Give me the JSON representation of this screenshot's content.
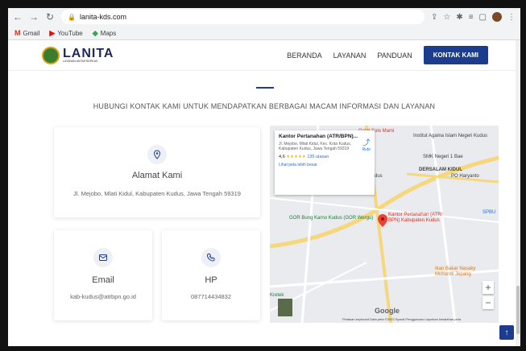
{
  "browser": {
    "url": "lanita-kds.com",
    "bookmarks": [
      {
        "label": "Gmail",
        "icon": "gmail-icon"
      },
      {
        "label": "YouTube",
        "icon": "youtube-icon"
      },
      {
        "label": "Maps",
        "icon": "maps-icon"
      }
    ]
  },
  "header": {
    "logo_title": "LANITA",
    "logo_sub": "LAYANAN ANTAR BERKAS",
    "nav": [
      "BERANDA",
      "LAYANAN",
      "PANDUAN"
    ],
    "contact_label": "KONTAK KAMI"
  },
  "section_title": "HUBUNGI KONTAK KAMI UNTUK MENDAPATKAN BERBAGAI MACAM INFORMASI DAN LAYANAN",
  "cards": {
    "address": {
      "title": "Alamat Kami",
      "text": "Jl. Mejobo, Mlati Kidul, Kabupaten Kudus, Jawa Tengah 59319"
    },
    "email": {
      "title": "Email",
      "text": "kab-kudus@atrbpn.go.id"
    },
    "phone": {
      "title": "HP",
      "text": "087714434832"
    }
  },
  "map": {
    "info_title": "Kantor Pertanahan (ATR/BPN)...",
    "info_address": "Jl. Mejobo, Mlati Kidul, Kec. Kota Kudus, Kabupaten Kudus, Jawa Tengah 59319",
    "rating": "4,6",
    "stars": "★★★★★",
    "reviews": "135 ulasan",
    "link": "Lihat peta lebih besar",
    "route": "Rute",
    "labels": {
      "pin": "Kantor Pertanahan (ATR/ BPN) Kabupaten Kudus",
      "institut": "Institut Agama Islam Negeri Kudus",
      "smk": "SMK Negeri 1 Bae",
      "dersalam": "DERSALAM KIDUL",
      "po": "PO Haryanto",
      "gor": "GOR Bung Karno Kudus (GOR Wergu)",
      "ikan": "Ikan Bakar Nasaky Mubarok Jepang",
      "kretek": "Kretek",
      "google": "Google",
      "footer": "Pintasan keyboard   Data peta ©2023   Syarat Penggunaan   Laporkan kesalahan peta"
    }
  },
  "colors": {
    "primary": "#1c3d8c",
    "map_bg": "#e8eaed"
  }
}
